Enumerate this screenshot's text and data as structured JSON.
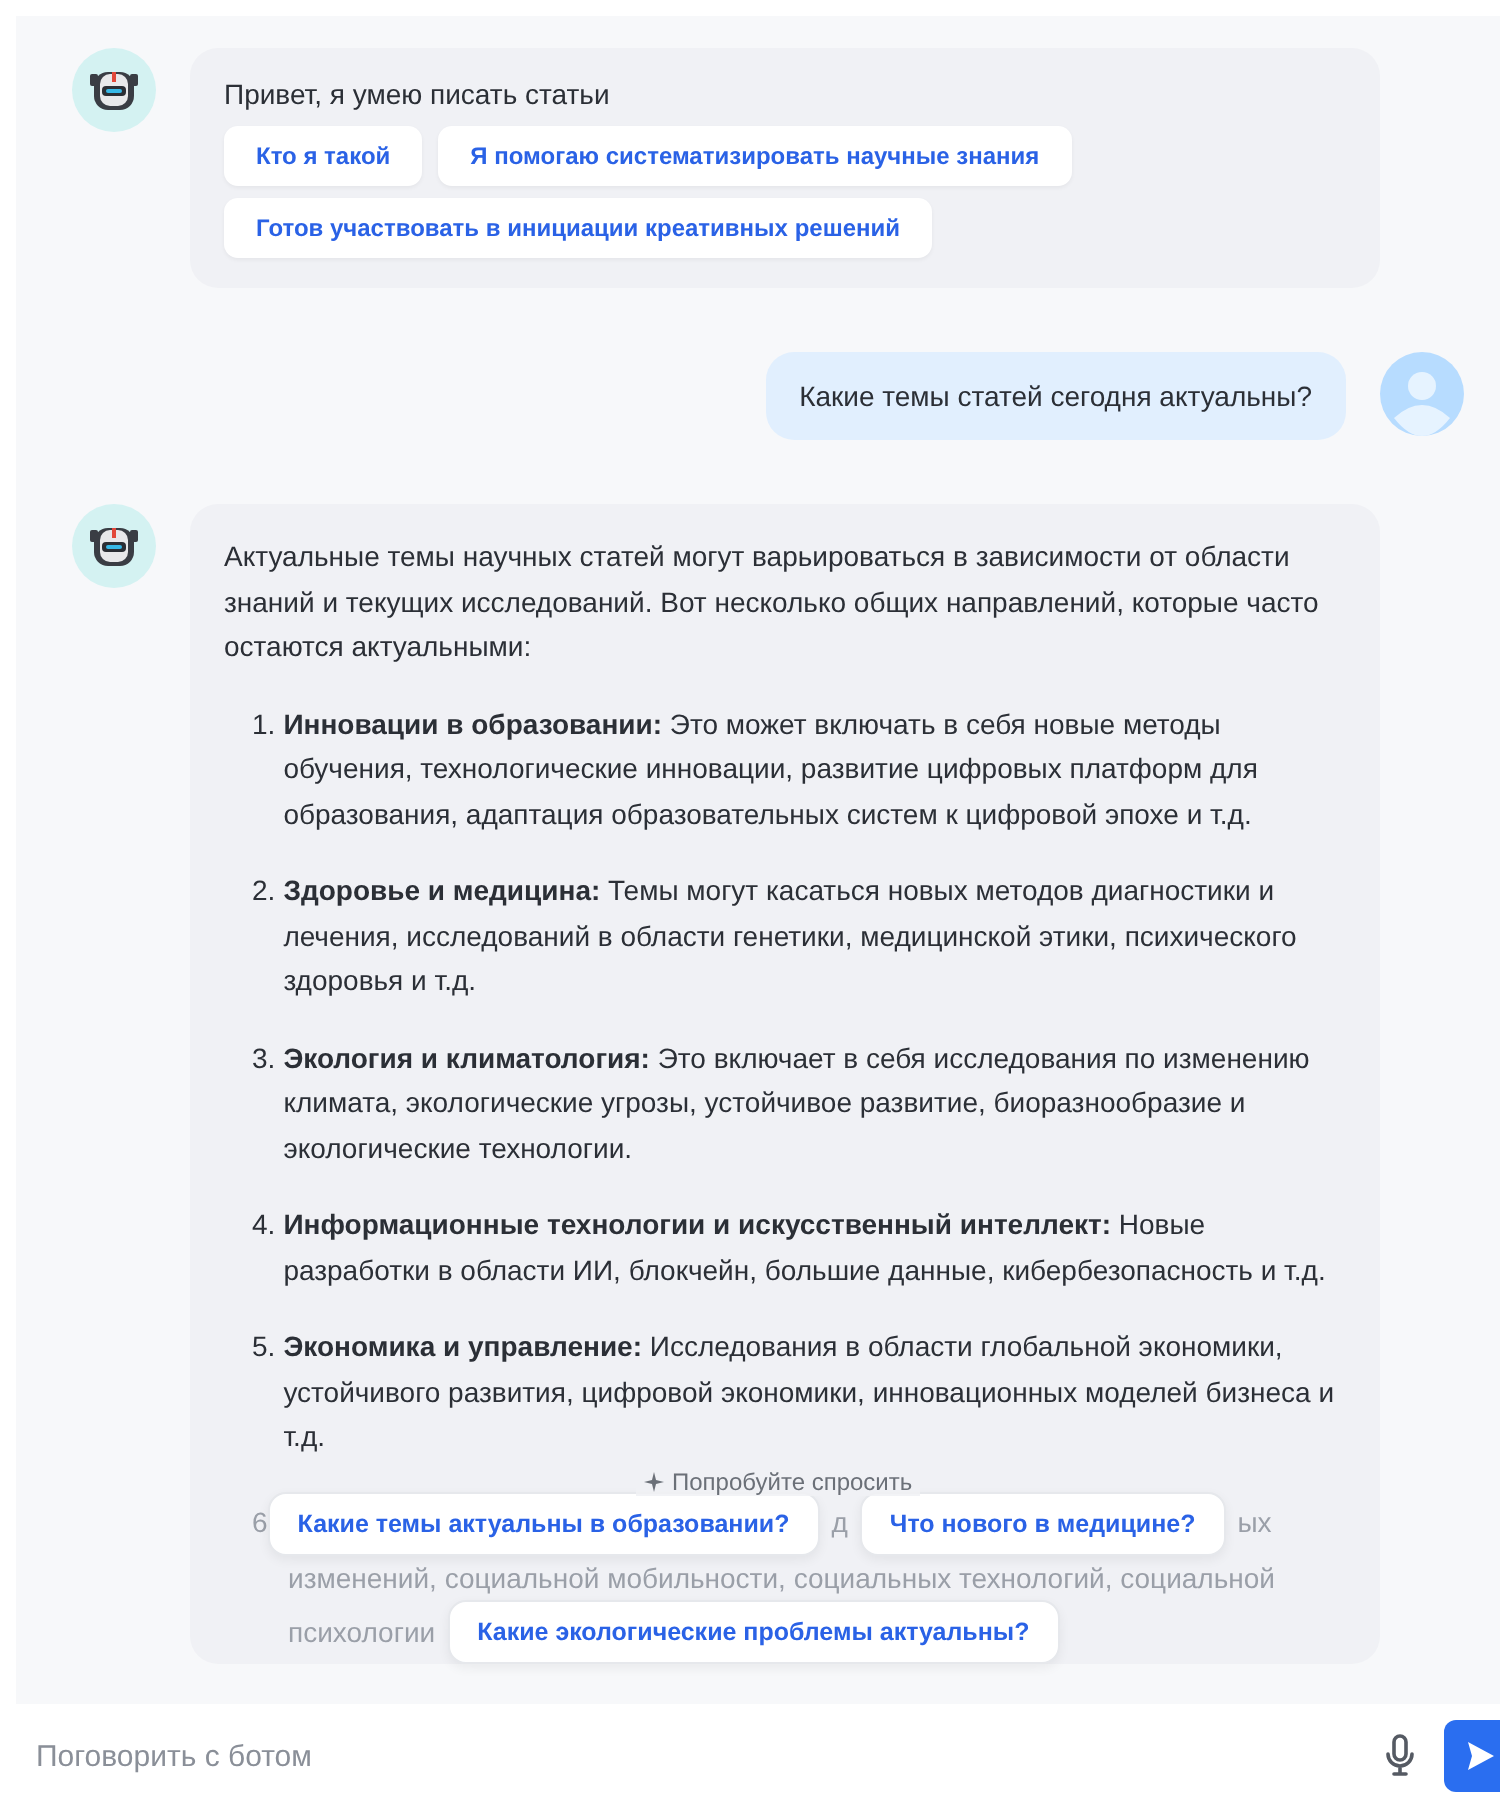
{
  "messages": [
    {
      "kind": "bot",
      "text": "Привет, я умею писать статьи",
      "chips": [
        "Кто я такой",
        "Я помогаю систематизировать научные знания",
        "Готов участвовать в инициации креативных решений"
      ]
    },
    {
      "kind": "user",
      "text": "Какие темы статей сегодня актуальны?"
    },
    {
      "kind": "article",
      "intro": "Актуальные темы научных статей могут варьироваться в зависимости от области знаний и текущих исследований. Вот несколько общих направлений, которые часто остаются актуальными:",
      "items": [
        {
          "number": "1.",
          "text": "**Инновации в образовании:** Это может включать в себя новые методы обучения, технологические инновации, развитие цифровых платформ для образования, адаптация образовательных систем к цифровой эпохе и т.д."
        },
        {
          "number": "2.",
          "text": "**Здоровье и медицина:** Темы могут касаться новых методов диагностики и лечения, исследований в области генетики, медицинской этики, психического здоровья и т.д."
        },
        {
          "number": "3.",
          "text": "**Экология и климатология:** Это включает в себя исследования по изменению климата, экологические угрозы, устойчивое развитие, биоразнообразие и экологические технологии."
        },
        {
          "number": "4.",
          "text": "**Информационные технологии и искусственный интеллект:** Новые разработки в области ИИ, блокчейн, большие данные, кибербезопасность и т.д."
        },
        {
          "number": "5.",
          "text": "**Экономика и управление:** Исследования в области глобальной экономики, устойчивого развития, цифровой экономики, инновационных моделей бизнеса и т.д."
        }
      ],
      "faded": {
        "line_1": [
          "6",
          "д",
          "ых"
        ],
        "line_2": "изменений, социальной мобильности, социальных технологий, социальной",
        "line_3": "психологии"
      }
    }
  ],
  "suggestions": {
    "label": "Попробуйте спросить",
    "buttons": [
      "Какие темы актуальны в образовании?",
      "Что нового в медицине?",
      "Какие экологические проблемы актуальны?"
    ]
  },
  "composer": {
    "placeholder": "Поговорить с ботом"
  }
}
